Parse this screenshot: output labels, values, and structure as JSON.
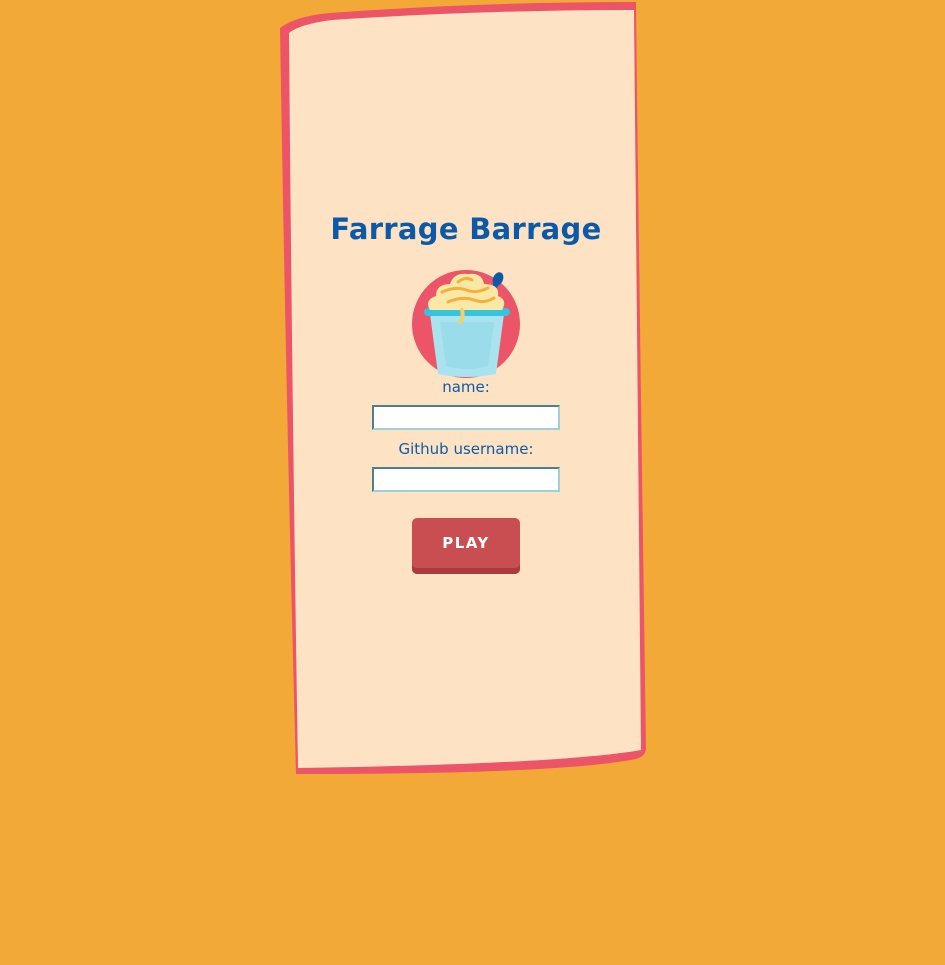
{
  "app": {
    "title": "Farrage Barrage",
    "logo_icon": "ice-cream-cup-icon"
  },
  "form": {
    "name_label": "name:",
    "name_value": "",
    "github_label": "Github username:",
    "github_value": "",
    "play_label": "PLAY"
  },
  "colors": {
    "background": "#f3a937",
    "card_fill": "#fde3c3",
    "card_border": "#ec5467",
    "title": "#0c5aa7",
    "button": "#c84e51"
  }
}
